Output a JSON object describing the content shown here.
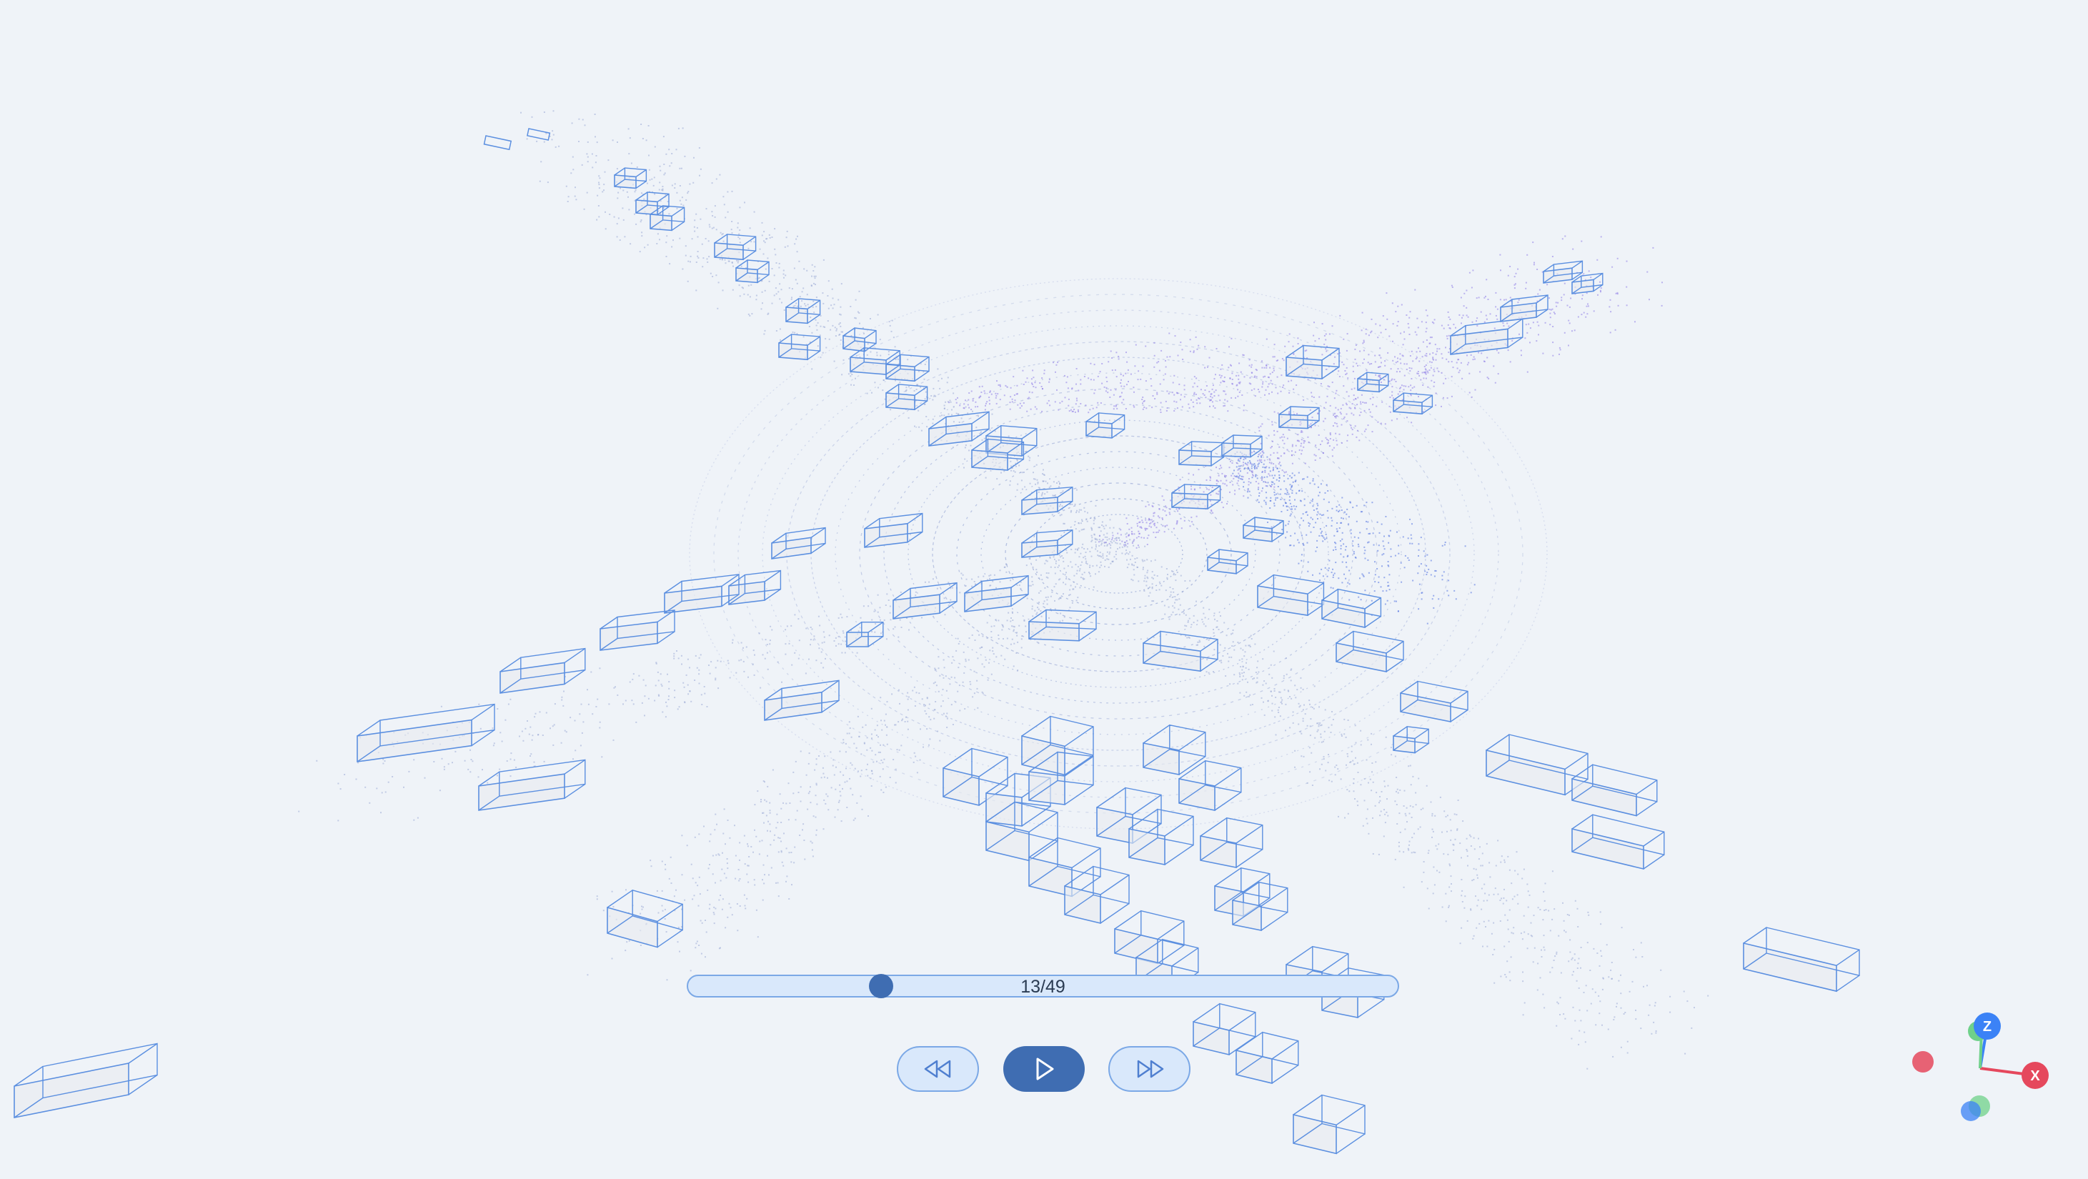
{
  "viewer": {
    "scene": "lidar-point-cloud-intersection",
    "accent_color": "#3f6db2",
    "box_color": "#5b8fe0",
    "point_colors": [
      "#9aa9d6",
      "#8e7be6",
      "#4f6fe0"
    ]
  },
  "playback": {
    "frame_label": "13/49",
    "current_frame": 13,
    "total_frames": 49,
    "rewind_icon": "rewind-icon",
    "play_icon": "play-icon",
    "fast_forward_icon": "fast-forward-icon"
  },
  "axes": {
    "z_label": "Z",
    "x_label": "X",
    "z_color": "#3b82f6",
    "x_color": "#e5485d",
    "y_color": "#6fd18a"
  }
}
